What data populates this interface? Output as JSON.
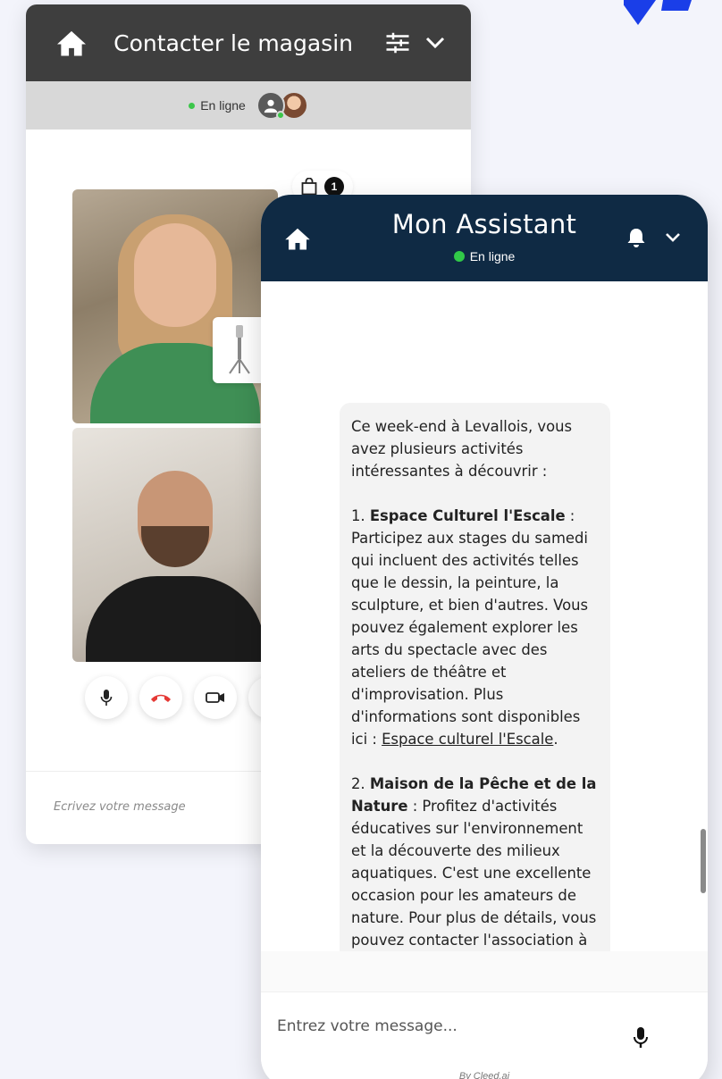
{
  "store_widget": {
    "title": "Contacter le magasin",
    "status": "En ligne",
    "cart_count": "1",
    "input_placeholder": "Ecrivez votre message"
  },
  "assistant": {
    "title": "Mon Assistant",
    "status": "En ligne",
    "message": {
      "intro": "Ce week-end à Levallois, vous avez plusieurs activités intéressantes à découvrir :",
      "item1_number": "1.",
      "item1_title": "Espace Culturel l'Escale",
      "item1_text": " : Participez aux stages du samedi qui incluent des activités telles que le dessin, la peinture, la sculpture, et bien d'autres. Vous pouvez également explorer les arts du spectacle avec des ateliers de théâtre et d'improvisation. Plus d'informations sont disponibles ici : ",
      "item1_link": "Espace culturel l'Escale",
      "item1_end": ".",
      "item2_number": "2.",
      "item2_title": "Maison de la Pêche et de la Nature",
      "item2_text": " : Profitez d'activités éducatives sur l'environnement et la découverte des milieux aquatiques. C'est une excellente occasion pour les amateurs de nature. Pour plus de détails, vous pouvez contacter l'association à"
    },
    "input_placeholder": "Entrez votre message...",
    "footer": "By Cleed.ai"
  },
  "colors": {
    "store_header": "#3e3e3e",
    "assistant_header": "#0f2a44",
    "online": "#31c948",
    "hangup": "#e53935"
  }
}
